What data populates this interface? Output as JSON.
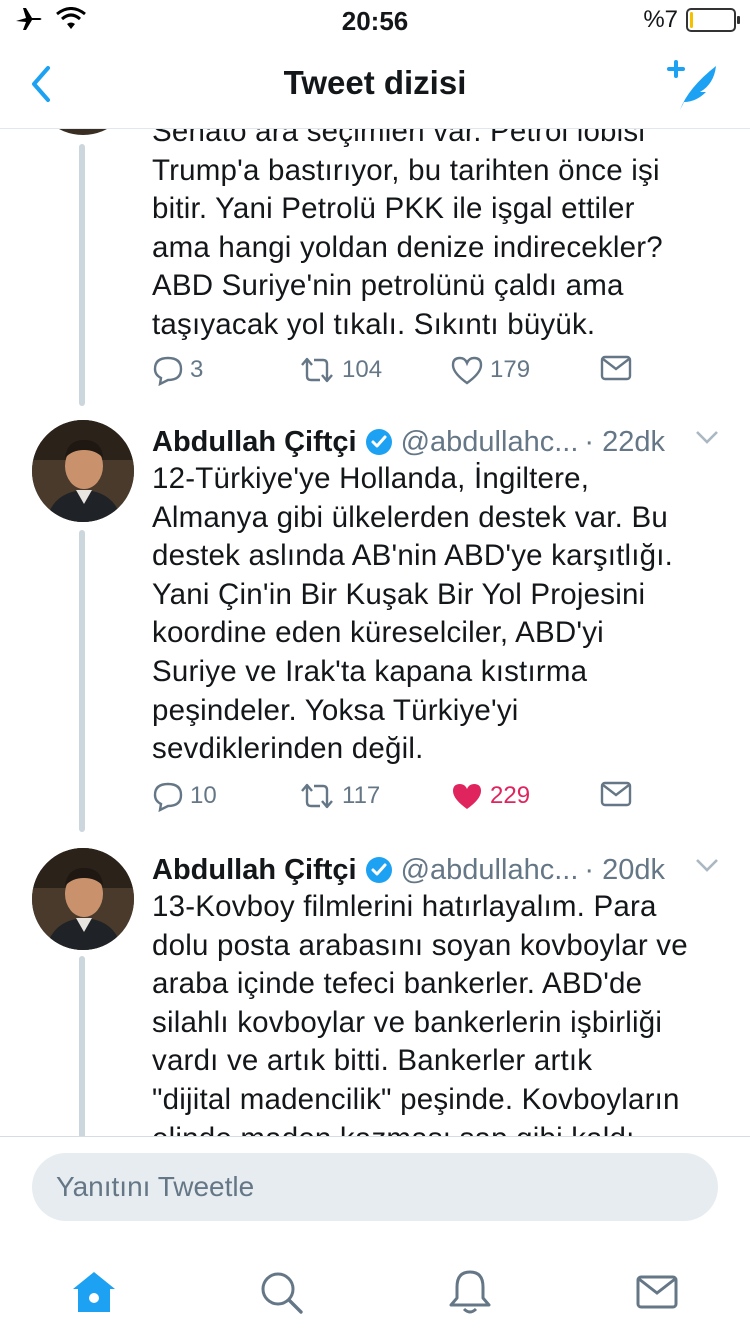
{
  "status_bar": {
    "time": "20:56",
    "battery_text": "%7",
    "battery_level": 0.07
  },
  "nav": {
    "title": "Tweet dizisi"
  },
  "colors": {
    "accent": "#1da1f2",
    "like": "#e0245e",
    "secondary": "#657786",
    "thread_line": "#ccd6dd"
  },
  "tweets": [
    {
      "text_lines": [
        "Senato ara seçimleri var. Petrol lobisi",
        "Trump'a bastırıyor, bu tarihten önce işi",
        "bitir. Yani Petrolü PKK ile işgal ettiler",
        "ama hangi yoldan denize indirecekler?",
        "ABD Suriye'nin petrolünü çaldı ama",
        "taşıyacak yol tıkalı. Sıkıntı büyük."
      ],
      "replies": "3",
      "retweets": "104",
      "likes": "179"
    },
    {
      "name": "Abdullah Çiftçi",
      "handle": "@abdullahc...",
      "time": "· 22dk",
      "text_lines": [
        "12-Türkiye'ye Hollanda, İngiltere,",
        "Almanya gibi ülkelerden destek var. Bu",
        "destek aslında AB'nin ABD'ye karşıtlığı.",
        "Yani Çin'in Bir Kuşak Bir Yol Projesini",
        "koordine eden küreselciler, ABD'yi",
        "Suriye ve Irak'ta kapana kıstırma",
        "peşindeler. Yoksa Türkiye'yi",
        "sevdiklerinden değil."
      ],
      "replies": "10",
      "retweets": "117",
      "likes": "229"
    },
    {
      "name": "Abdullah Çiftçi",
      "handle": "@abdullahc...",
      "time": "· 20dk",
      "text_lines": [
        "13-Kovboy filmlerini hatırlayalım. Para",
        "dolu posta arabasını soyan kovboylar ve",
        "araba içinde tefeci bankerler. ABD'de",
        "silahlı kovboylar ve bankerlerin işbirliği",
        "vardı ve artık bitti. Bankerler artık",
        "\"dijital madencilik\" peşinde. Kovboyların",
        "elinde maden kazması sap gibi kaldı."
      ]
    }
  ],
  "reply": {
    "placeholder": "Yanıtını Tweetle"
  },
  "tabs": [
    {
      "icon": "home-icon",
      "active": true
    },
    {
      "icon": "search-icon",
      "active": false
    },
    {
      "icon": "bell-icon",
      "active": false
    },
    {
      "icon": "mail-icon",
      "active": false
    }
  ]
}
